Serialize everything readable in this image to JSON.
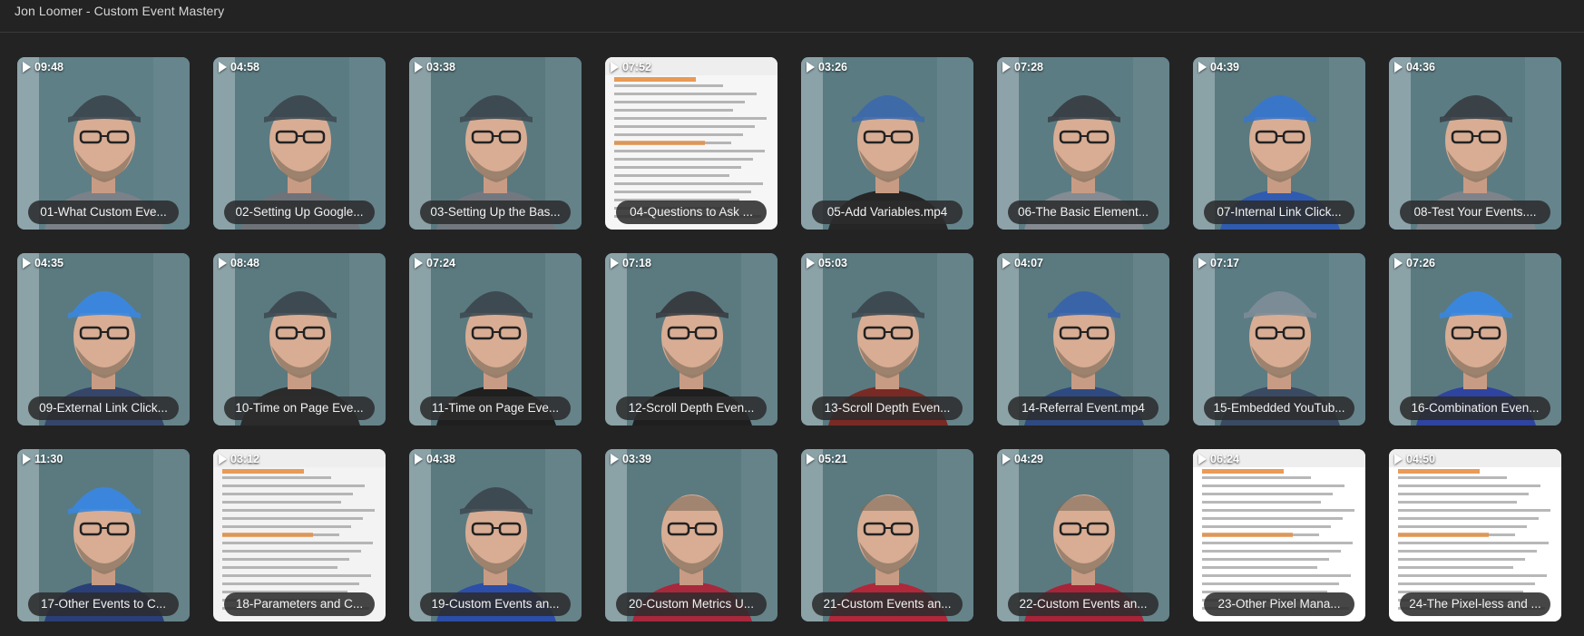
{
  "window": {
    "title": "Jon Loomer - Custom Event Mastery"
  },
  "colors": {
    "background": "#232324",
    "label_bg": "#2c2c2e",
    "text": "#f2f2f2"
  },
  "videos": [
    {
      "duration": "09:48",
      "label": "01-What Custom Eve...",
      "thumb": "person",
      "wall": "#5e7f86",
      "hat": "#3e4a52",
      "shirt": "#7b8188"
    },
    {
      "duration": "04:58",
      "label": "02-Setting Up Google...",
      "thumb": "person",
      "wall": "#5a7b82",
      "hat": "#3e4a52",
      "shirt": "#6e7379"
    },
    {
      "duration": "03:38",
      "label": "03-Setting Up the Bas...",
      "thumb": "person",
      "wall": "#59797f",
      "hat": "#3e4a52",
      "shirt": "#737880"
    },
    {
      "duration": "07:52",
      "label": "04-Questions to Ask ...",
      "thumb": "doc",
      "wall": "#f6f6f6",
      "hat": "",
      "shirt": ""
    },
    {
      "duration": "03:26",
      "label": "05-Add Variables.mp4",
      "thumb": "person",
      "wall": "#5a7b82",
      "hat": "#3e6aa8",
      "shirt": "#262626"
    },
    {
      "duration": "07:28",
      "label": "06-The Basic Element...",
      "thumb": "person",
      "wall": "#5c7c83",
      "hat": "#3a4248",
      "shirt": "#858b92"
    },
    {
      "duration": "04:39",
      "label": "07-Internal Link Click...",
      "thumb": "person",
      "wall": "#5a7a80",
      "hat": "#3a76c8",
      "shirt": "#2f5bb0"
    },
    {
      "duration": "04:36",
      "label": "08-Test Your Events....",
      "thumb": "person",
      "wall": "#5c7c84",
      "hat": "#3a4248",
      "shirt": "#7e838a"
    },
    {
      "duration": "04:35",
      "label": "09-External Link Click...",
      "thumb": "person",
      "wall": "#5a7a80",
      "hat": "#3b86dc",
      "shirt": "#35466a"
    },
    {
      "duration": "08:48",
      "label": "10-Time on Page Eve...",
      "thumb": "person",
      "wall": "#5a7a80",
      "hat": "#3e4a52",
      "shirt": "#2b2b2b"
    },
    {
      "duration": "07:24",
      "label": "11-Time on Page Eve...",
      "thumb": "person",
      "wall": "#5a7a80",
      "hat": "#3e4a52",
      "shirt": "#1f1f1f"
    },
    {
      "duration": "07:18",
      "label": "12-Scroll Depth Even...",
      "thumb": "person",
      "wall": "#5a7a80",
      "hat": "#383d42",
      "shirt": "#1f1f1f"
    },
    {
      "duration": "05:03",
      "label": "13-Scroll Depth Even...",
      "thumb": "person",
      "wall": "#5a7a80",
      "hat": "#3e4a52",
      "shirt": "#7a2a24"
    },
    {
      "duration": "04:07",
      "label": "14-Referral Event.mp4",
      "thumb": "person",
      "wall": "#5a7a80",
      "hat": "#3a64a8",
      "shirt": "#2f4a80"
    },
    {
      "duration": "07:17",
      "label": "15-Embedded YouTub...",
      "thumb": "person",
      "wall": "#5c7c84",
      "hat": "#7c8c96",
      "shirt": "#3a4a62"
    },
    {
      "duration": "07:26",
      "label": "16-Combination Even...",
      "thumb": "person",
      "wall": "#5a7a80",
      "hat": "#3a86dc",
      "shirt": "#2f44a0"
    },
    {
      "duration": "11:30",
      "label": "17-Other Events to C...",
      "thumb": "person",
      "wall": "#5a7a80",
      "hat": "#3b86dc",
      "shirt": "#2a3f78"
    },
    {
      "duration": "03:12",
      "label": "18-Parameters and C...",
      "thumb": "doc",
      "wall": "#f3f3f3",
      "hat": "",
      "shirt": ""
    },
    {
      "duration": "04:38",
      "label": "19-Custom Events an...",
      "thumb": "person",
      "wall": "#5a7a80",
      "hat": "#3e4a52",
      "shirt": "#2c4ea8"
    },
    {
      "duration": "03:39",
      "label": "20-Custom Metrics U...",
      "thumb": "person",
      "wall": "#5a7a80",
      "hat": "",
      "shirt": "#a8283c"
    },
    {
      "duration": "05:21",
      "label": "21-Custom Events an...",
      "thumb": "person",
      "wall": "#5a7a80",
      "hat": "",
      "shirt": "#b0283a"
    },
    {
      "duration": "04:29",
      "label": "22-Custom Events an...",
      "thumb": "person",
      "wall": "#5a7a80",
      "hat": "",
      "shirt": "#a82438"
    },
    {
      "duration": "06:24",
      "label": "23-Other Pixel Mana...",
      "thumb": "doc",
      "wall": "#ffffff",
      "hat": "",
      "shirt": ""
    },
    {
      "duration": "04:50",
      "label": "24-The Pixel-less and ...",
      "thumb": "doc",
      "wall": "#ffffff",
      "hat": "",
      "shirt": ""
    }
  ]
}
